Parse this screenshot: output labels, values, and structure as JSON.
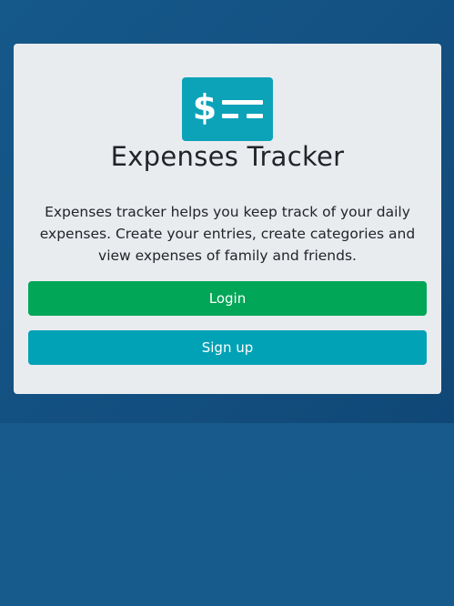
{
  "app": {
    "title": "Expenses Tracker",
    "description": "Expenses tracker helps you keep track of your daily expenses. Create your entries, create categories and view expenses of family and friends.",
    "logo_icon": "dollar-lines-icon"
  },
  "actions": {
    "login_label": "Login",
    "signup_label": "Sign up"
  },
  "colors": {
    "background": "#16578a",
    "card": "#e9ecef",
    "logo": "#0ca2b8",
    "login_button": "#02a657",
    "signup_button": "#02a2b6",
    "text": "#212529"
  }
}
